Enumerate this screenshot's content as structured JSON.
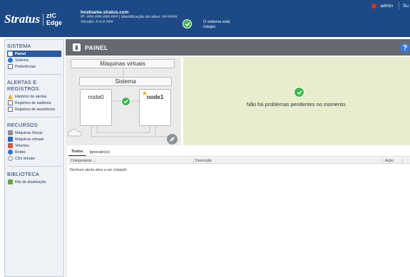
{
  "header": {
    "brand": "Stratus",
    "product": "ztC Edge",
    "hostname": "hostname.stratus.com",
    "ip_line": "IP: ###.###.###.### | Identificação do ativo: ##-####",
    "version_line": "Versão: #.#.#-###",
    "system_status_line1": "O sistema está",
    "system_status_line2": "íntegro",
    "user": "admin",
    "support": "Su"
  },
  "sidebar": {
    "sections": [
      {
        "title": "SISTEMA",
        "items": [
          "Painel",
          "Sistema",
          "Preferências"
        ]
      },
      {
        "title": "ALERTAS E REGISTROS",
        "items": [
          "Histórico de alertas",
          "Registros de auditoria",
          "Registros de assistência"
        ]
      },
      {
        "title": "RECURSOS",
        "items": [
          "Máquinas físicas",
          "Máquinas virtuais",
          "Volumes",
          "Redes",
          "CDs virtuais"
        ]
      },
      {
        "title": "BIBLIOTECA",
        "items": [
          "Kits de atualização"
        ]
      }
    ]
  },
  "main": {
    "title": "PAINEL",
    "help_label": "?",
    "diagram": {
      "vms_label": "Máquinas virtuais",
      "system_label": "Sistema",
      "node0_label": "node0",
      "node1_label": "node1"
    },
    "issues_text": "Não há problemas pendentes no momento.",
    "tabs": [
      "Todos",
      "Ignorado(s)"
    ],
    "table": {
      "headers": [
        "Componente ⌄",
        "Descrição",
        "Ação"
      ],
      "empty_message": "Nenhum alerta ativo a ser relatado"
    }
  },
  "colors": {
    "header_bg": "#1d4a86",
    "ok_green": "#43b551",
    "active_nav": "#2a5aa0",
    "issues_bg": "#e9eccd",
    "alert_red": "#e3301c",
    "help_blue": "#3b7ad2"
  },
  "icons": {
    "painel": "dashboard-icon",
    "sistema": "globe-icon",
    "preferencias": "preferences-icon",
    "historico": "warning-icon",
    "auditoria": "document-icon",
    "assistencia": "document-edit-icon",
    "maquinas_fisicas": "server-icon",
    "maquinas_virtuais": "vm-icon",
    "volumes": "volume-icon",
    "redes": "network-icon",
    "cds": "cd-icon",
    "kits": "kit-icon"
  }
}
